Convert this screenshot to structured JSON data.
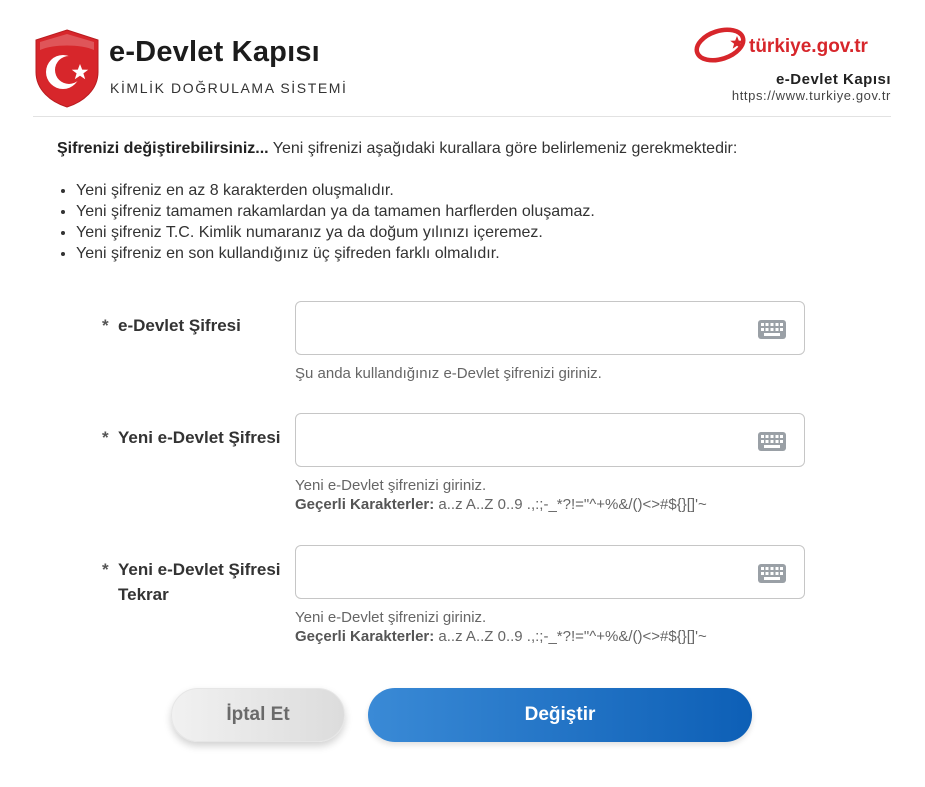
{
  "header": {
    "brand_title": "e-Devlet Kapısı",
    "brand_subtitle": "KİMLİK DOĞRULAMA SİSTEMİ",
    "portal_logo_text": "türkiye.gov.tr",
    "portal_title": "e-Devlet Kapısı",
    "portal_url": "https://www.turkiye.gov.tr"
  },
  "intro": {
    "bold": "Şifrenizi değiştirebilirsiniz...",
    "text": " Yeni şifrenizi aşağıdaki kurallara göre belirlemeniz gerekmektedir:"
  },
  "rules": [
    "Yeni şifreniz en az 8 karakterden oluşmalıdır.",
    "Yeni şifreniz tamamen rakamlardan ya da tamamen harflerden oluşamaz.",
    "Yeni şifreniz T.C. Kimlik numaranız ya da doğum yılınızı içeremez.",
    "Yeni şifreniz en son kullandığınız üç şifreden farklı olmalıdır."
  ],
  "form": {
    "required_mark": "*",
    "fields": [
      {
        "label": "e-Devlet Şifresi",
        "value": "",
        "help": "Şu anda kullandığınız e-Devlet şifrenizi giriniz."
      },
      {
        "label": "Yeni e-Devlet Şifresi",
        "value": "",
        "help": "Yeni e-Devlet şifrenizi giriniz.",
        "chars_label": "Geçerli Karakterler:",
        "chars": " a..z A..Z 0..9 .,:;-_*?!=\"^+%&/()<>#${}[]'~"
      },
      {
        "label": "Yeni e-Devlet Şifresi Tekrar",
        "value": "",
        "help": "Yeni e-Devlet şifrenizi giriniz.",
        "chars_label": "Geçerli Karakterler:",
        "chars": " a..z A..Z 0..9 .,:;-_*?!=\"^+%&/()<>#${}[]'~"
      }
    ]
  },
  "buttons": {
    "cancel": "İptal Et",
    "submit": "Değiştir"
  },
  "colors": {
    "brand_red": "#d7262b",
    "primary_blue": "#1469c2",
    "keyboard_icon": "#9aa0a6"
  },
  "icons": {
    "shield": "turkish-crescent-star-shield",
    "keyboard": "keyboard-icon"
  }
}
